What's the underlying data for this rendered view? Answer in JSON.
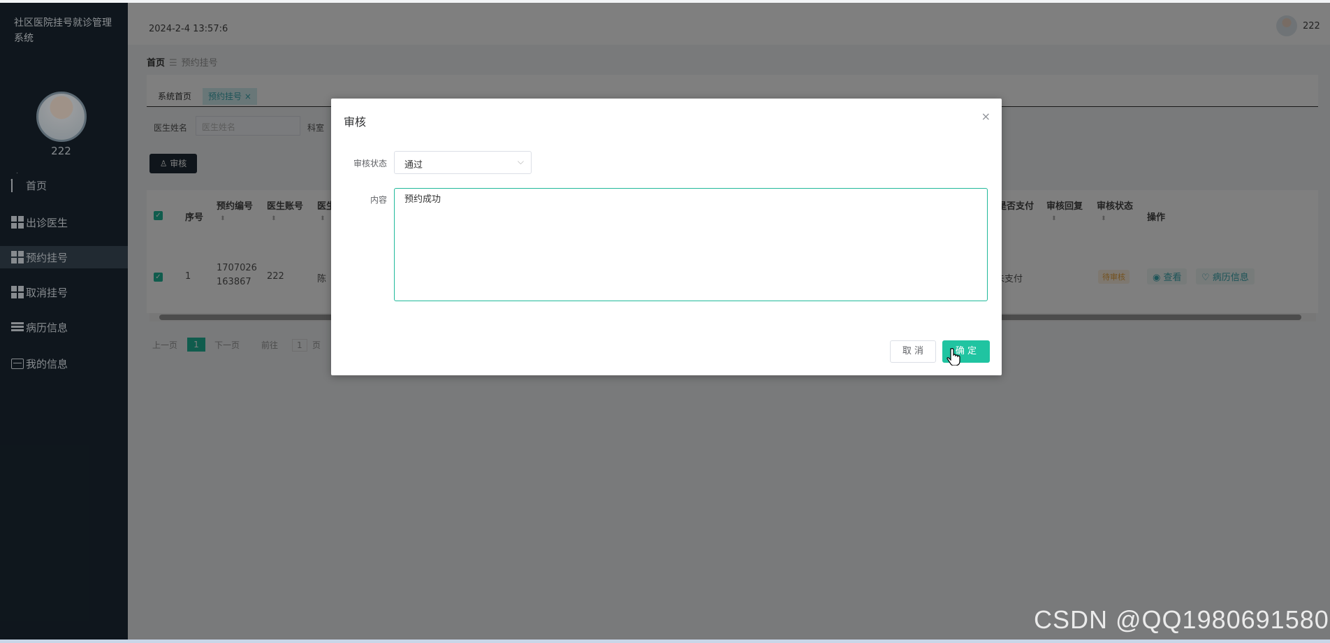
{
  "app": {
    "title": "社区医院挂号就诊管理系统",
    "user": "222"
  },
  "topbar": {
    "time": "2024-2-4 13:57:6",
    "user": "222"
  },
  "sidebar": {
    "items": [
      {
        "label": "首页",
        "icon": "home-icon"
      },
      {
        "label": "出诊医生",
        "icon": "grid-icon"
      },
      {
        "label": "预约挂号",
        "icon": "grid-icon",
        "active": true
      },
      {
        "label": "取消挂号",
        "icon": "grid-icon"
      },
      {
        "label": "病历信息",
        "icon": "list-icon"
      },
      {
        "label": "我的信息",
        "icon": "card-icon"
      }
    ]
  },
  "breadcrumb": {
    "home": "首页",
    "sep": "☰",
    "current": "预约挂号"
  },
  "tabs": [
    {
      "label": "系统首页"
    },
    {
      "label": "预约挂号 ×"
    }
  ],
  "search": {
    "doctor_label": "医生姓名",
    "doctor_placeholder": "医生姓名",
    "dept_label": "科室"
  },
  "toolbar": {
    "audit_label": "♙ 审核"
  },
  "table": {
    "headers_left": [
      "序号",
      "预约编号",
      "医生账号",
      "医生"
    ],
    "headers_right": [
      "是否支付",
      "审核回复",
      "审核状态",
      "操作"
    ],
    "row": {
      "index": "1",
      "order_no_1": "1707026",
      "order_no_2": "163867",
      "doctor_account": "222",
      "doctor_name_partial": "陈",
      "paid": "未支付",
      "status": "待审核",
      "view": "◉ 查看",
      "record": "♡ 病历信息"
    }
  },
  "pager": {
    "prev": "上一页",
    "page": "1",
    "next": "下一页",
    "goto": "前往",
    "goto_value": "1",
    "unit": "页"
  },
  "dialog": {
    "title": "审核",
    "close": "×",
    "status_label": "审核状态",
    "status_value": "通过",
    "content_label": "内容",
    "content_value": "预约成功",
    "cancel": "取 消",
    "ok": "确 定"
  },
  "watermark": "CSDN @QQ1980691580",
  "colors": {
    "accent": "#20c4a1",
    "sidebar": "#17232d"
  }
}
